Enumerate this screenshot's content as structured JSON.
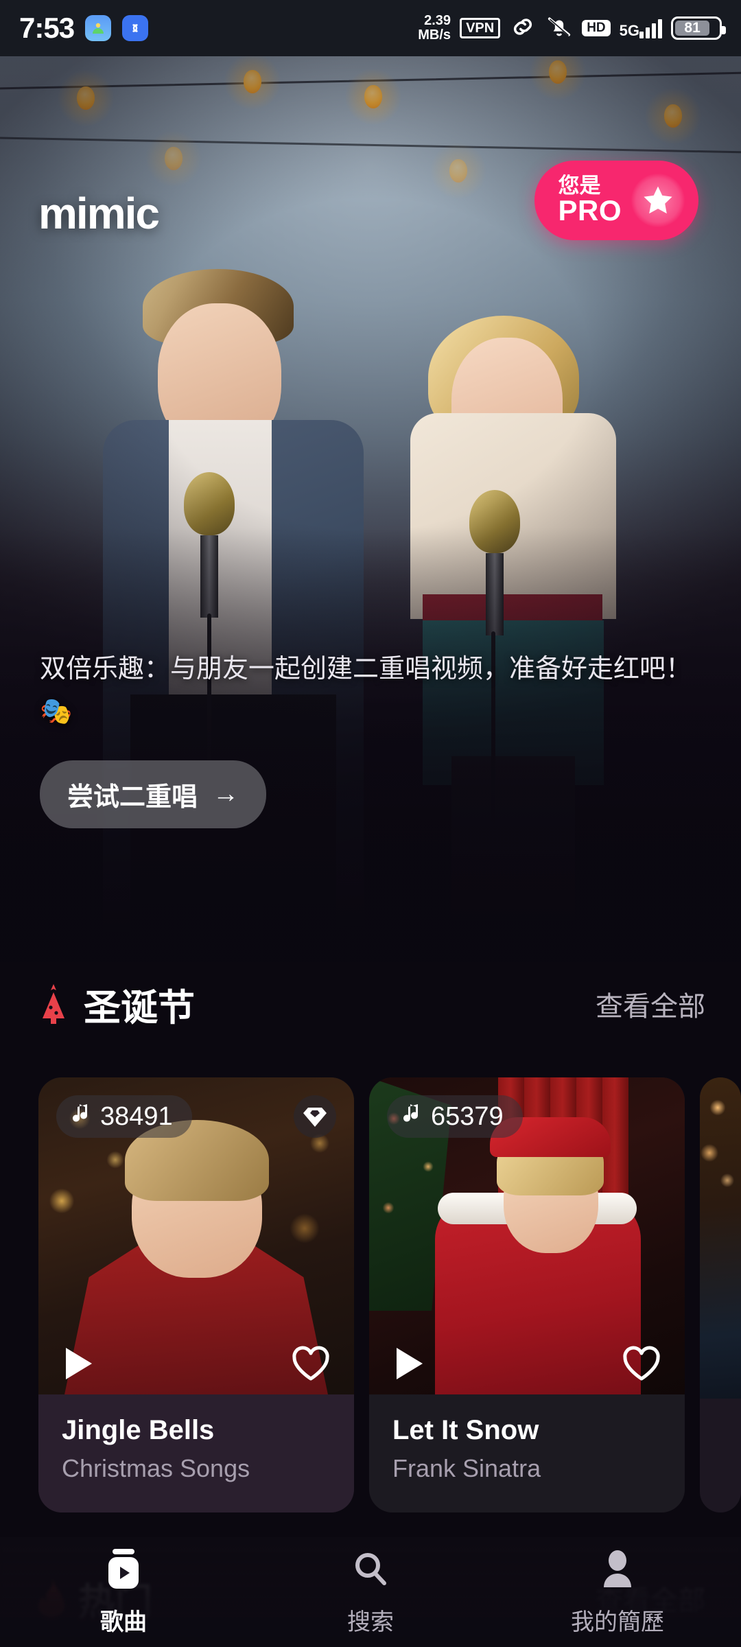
{
  "status_bar": {
    "time": "7:53",
    "app_icons": [
      "android-settings-icon",
      "link-app-icon"
    ],
    "network_speed": "2.39",
    "network_speed_unit": "MB/s",
    "vpn_label": "VPN",
    "hd_label": "HD",
    "network_type": "5G",
    "battery_percent": "81",
    "icons": [
      "link-icon",
      "bell-muted-icon",
      "signal-bars-icon",
      "battery-icon"
    ]
  },
  "hero": {
    "logo": "mimic",
    "pro_badge": {
      "line1": "您是",
      "line2": "PRO",
      "icon": "star-icon",
      "color": "#f7276e"
    },
    "promo_text": "双倍乐趣：与朋友一起创建二重唱视频，准备好走红吧！🎭",
    "cta_label": "尝试二重唱",
    "cta_arrow": "→"
  },
  "section": {
    "icon": "christmas-tree-icon",
    "icon_color": "#e8414a",
    "title": "圣诞节",
    "see_all": "查看全部"
  },
  "cards": [
    {
      "count": "38491",
      "count_icon": "music-note-icon",
      "badge_icon": "diamond-icon",
      "has_badge": true,
      "play_icon": "play-icon",
      "like_icon": "heart-outline-icon",
      "title": "Jingle Bells",
      "artist": "Christmas Songs"
    },
    {
      "count": "65379",
      "count_icon": "music-note-icon",
      "badge_icon": "",
      "has_badge": false,
      "play_icon": "play-icon",
      "like_icon": "heart-outline-icon",
      "title": "Let It Snow",
      "artist": "Frank Sinatra"
    }
  ],
  "next_section": {
    "icon": "fire-icon",
    "title": "热门",
    "see_all": "查看全部"
  },
  "bottom_nav": {
    "items": [
      {
        "label": "歌曲",
        "icon": "video-play-icon",
        "active": true
      },
      {
        "label": "搜索",
        "icon": "search-icon",
        "active": false
      },
      {
        "label": "我的簡歷",
        "icon": "person-icon",
        "active": false
      }
    ]
  }
}
